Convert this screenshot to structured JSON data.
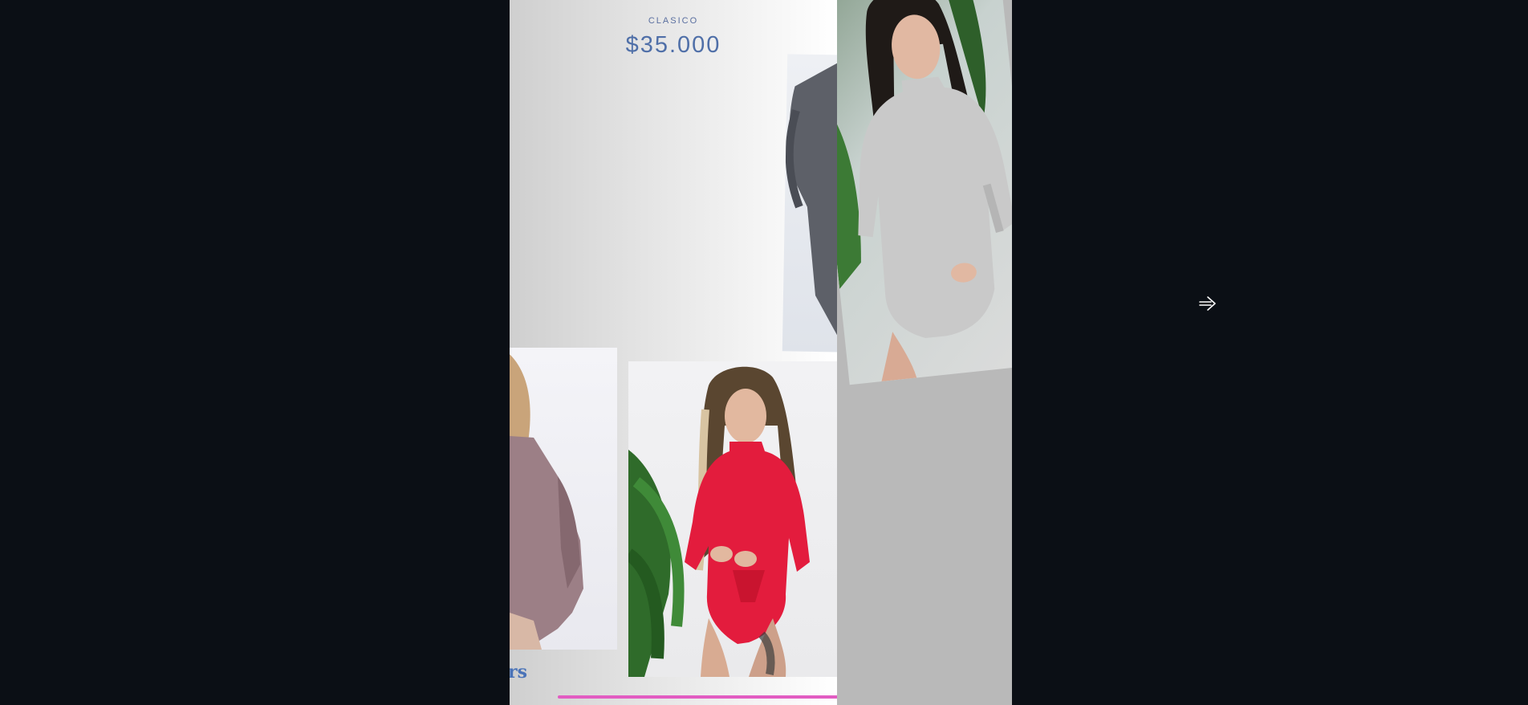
{
  "viewer": {
    "label": "CLASICO",
    "price": "$35.000",
    "brand_fragment": "rs"
  },
  "icons": {
    "next": "arrow-right-icon"
  },
  "colors": {
    "background": "#0b0f15",
    "label": "#5a6fa0",
    "price": "#4f6fa8",
    "brand": "#4a73b8",
    "accent_line": "#e25cc2",
    "bodysuit_red": "#e31c3d",
    "bodysuit_mauve": "#9c7f86",
    "bodysuit_grey": "#c9c9c9",
    "bodysuit_charcoal": "#5d6068"
  }
}
